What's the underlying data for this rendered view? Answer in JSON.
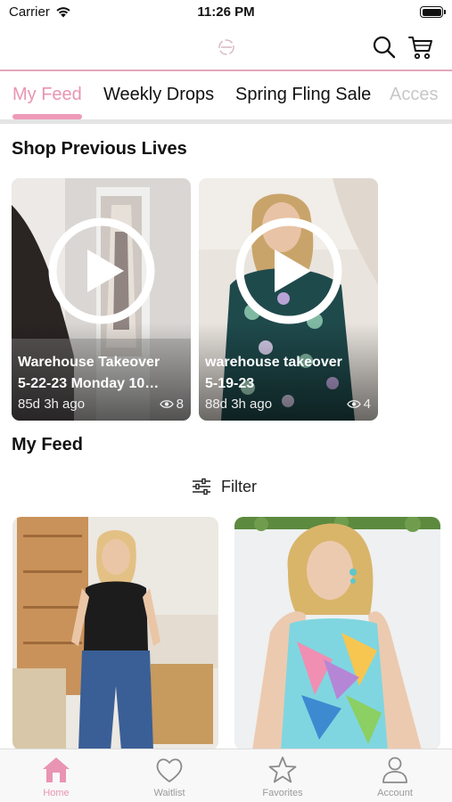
{
  "status_bar": {
    "carrier": "Carrier",
    "time": "11:26 PM"
  },
  "nav": {
    "search_icon": "search-icon",
    "cart_icon": "cart-icon",
    "logo_icon": "brand-logo"
  },
  "tabs": [
    {
      "label": "My Feed",
      "active": true
    },
    {
      "label": "Weekly Drops",
      "active": false
    },
    {
      "label": "Spring Fling Sale",
      "active": false
    },
    {
      "label": "Acces",
      "active": false
    }
  ],
  "previous_lives": {
    "title": "Shop Previous Lives",
    "items": [
      {
        "title_line1": "Warehouse Takeover",
        "title_line2": "5-22-23 Monday 10…",
        "age": "85d 3h ago",
        "views": "8"
      },
      {
        "title_line1": "warehouse takeover",
        "title_line2": "5-19-23",
        "age": "88d 3h ago",
        "views": "4"
      }
    ]
  },
  "feed": {
    "title": "My Feed",
    "filter_label": "Filter"
  },
  "bottom_tabs": [
    {
      "label": "Home",
      "icon": "home-icon",
      "active": true
    },
    {
      "label": "Waitlist",
      "icon": "heart-icon",
      "active": false
    },
    {
      "label": "Favorites",
      "icon": "star-icon",
      "active": false
    },
    {
      "label": "Account",
      "icon": "person-icon",
      "active": false
    }
  ],
  "colors": {
    "accent_pink": "#e994b3",
    "divider_pink": "#e6a7bd",
    "inactive_gray": "#9a9a9a"
  }
}
